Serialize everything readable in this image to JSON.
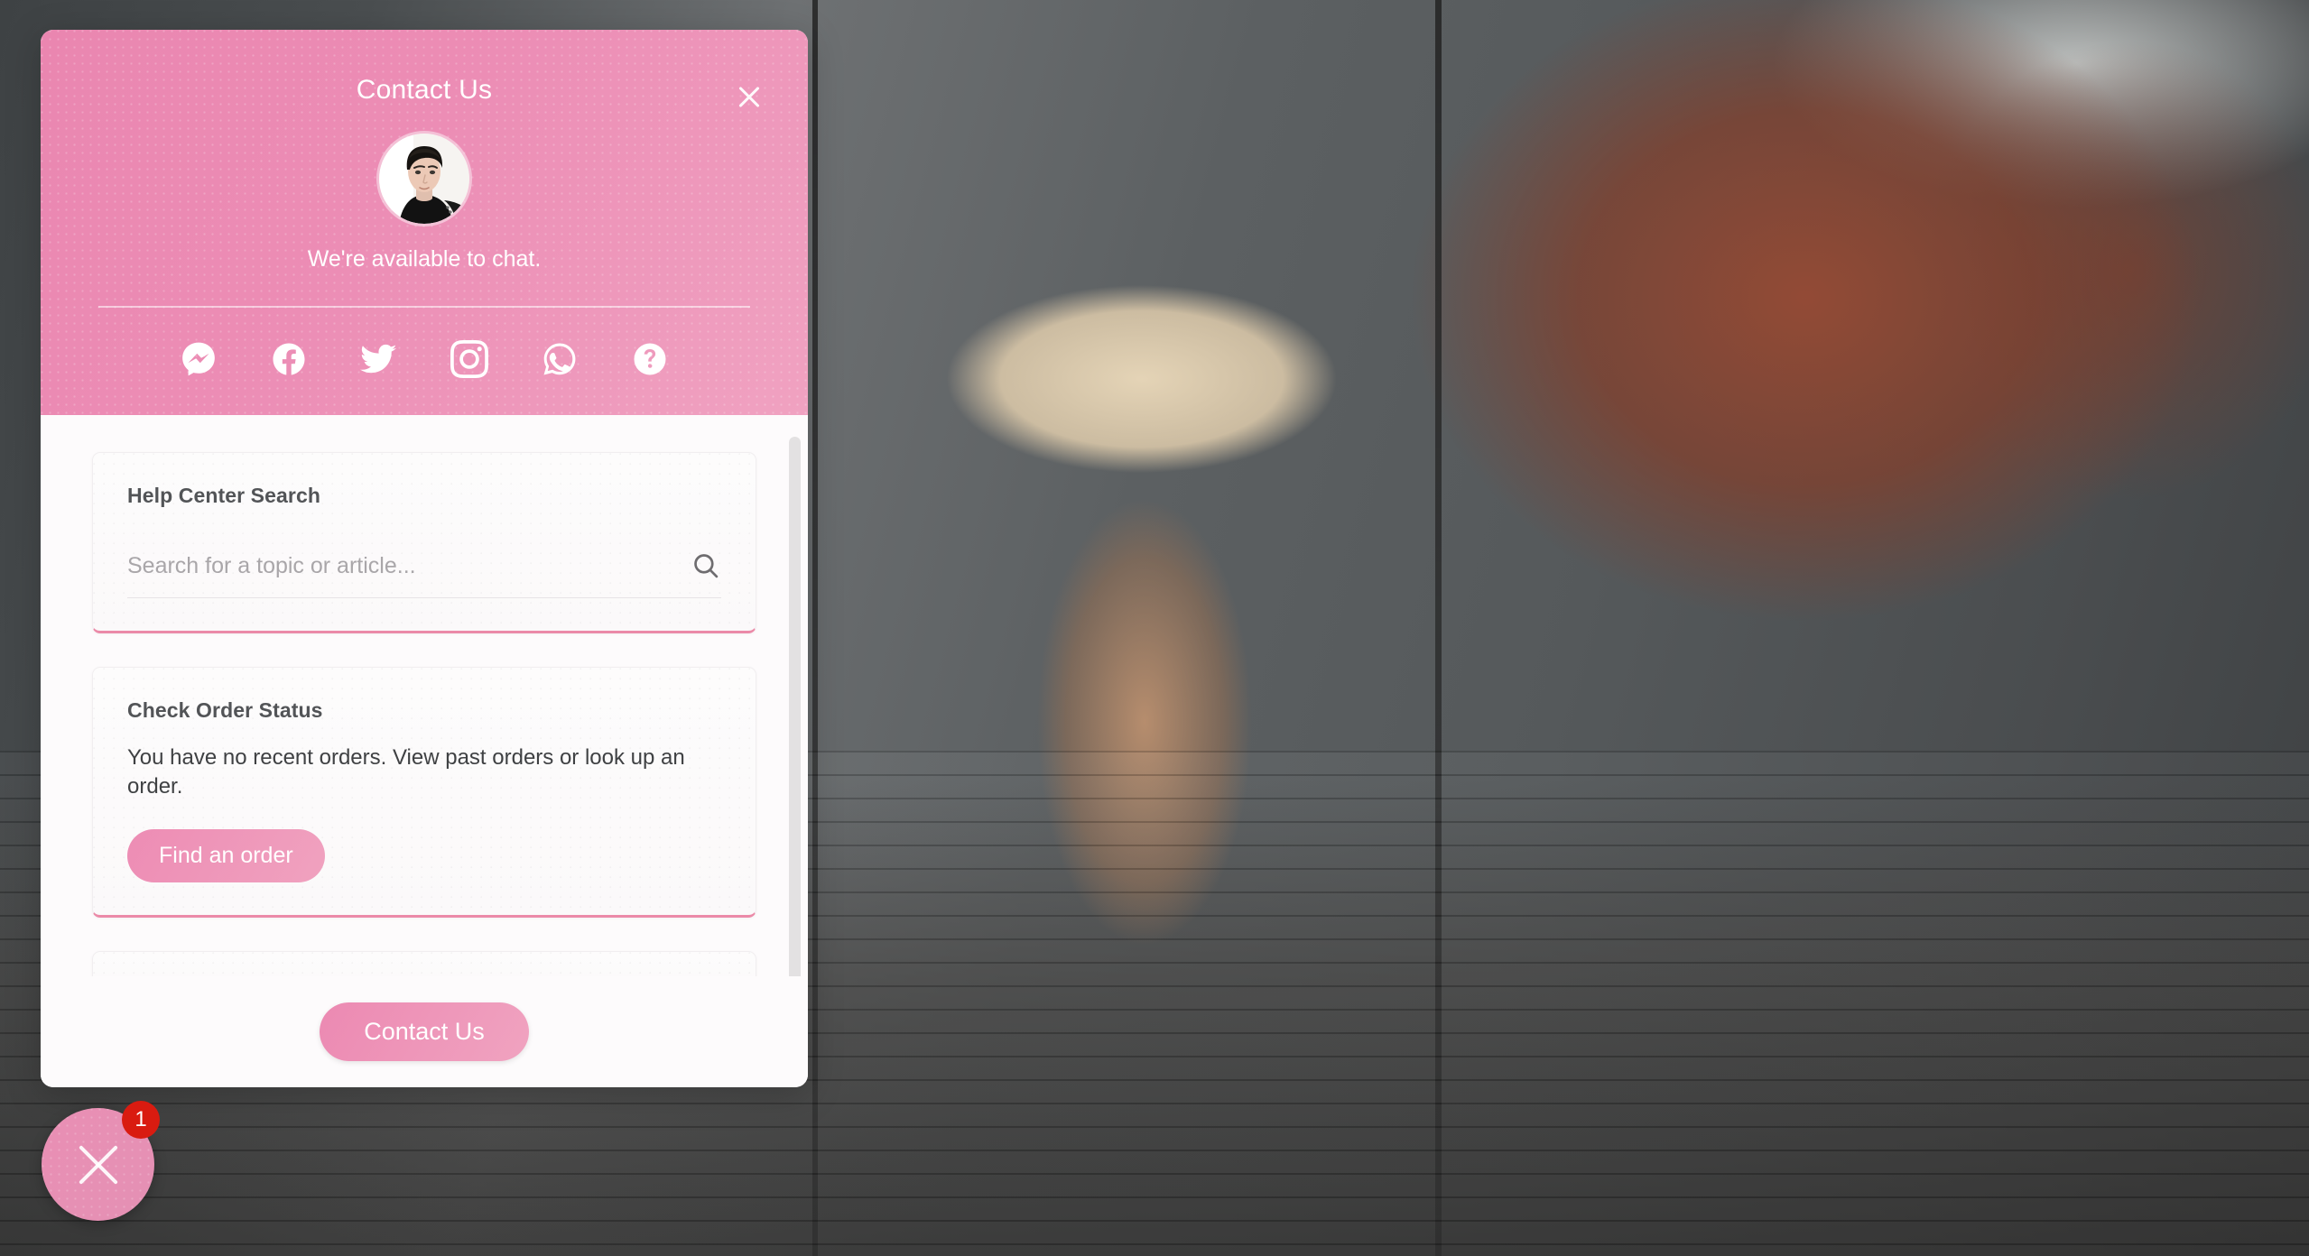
{
  "widget": {
    "header": {
      "title": "Contact Us",
      "close_icon": "close-icon",
      "avatar_alt": "agent-avatar",
      "availability_text": "We're available to chat.",
      "background_color": "#ec8db5",
      "social_links": [
        {
          "name": "messenger",
          "label": "Messenger"
        },
        {
          "name": "facebook",
          "label": "Facebook"
        },
        {
          "name": "twitter",
          "label": "Twitter"
        },
        {
          "name": "instagram",
          "label": "Instagram"
        },
        {
          "name": "whatsapp",
          "label": "WhatsApp"
        },
        {
          "name": "help",
          "label": "Help"
        }
      ]
    },
    "cards": [
      {
        "title": "Help Center Search",
        "search_value": "",
        "search_placeholder": "Search for a topic or article...",
        "search_icon": "search-icon"
      },
      {
        "title": "Check Order Status",
        "text": "You have no recent orders. View past orders or look up an order.",
        "button_label": "Find an order"
      }
    ],
    "footer": {
      "button_label": "Contact Us"
    },
    "accent_color": "#ec8db5",
    "badge_color": "#d91b10"
  },
  "launcher": {
    "icon": "close-icon",
    "badge_count": "1"
  }
}
